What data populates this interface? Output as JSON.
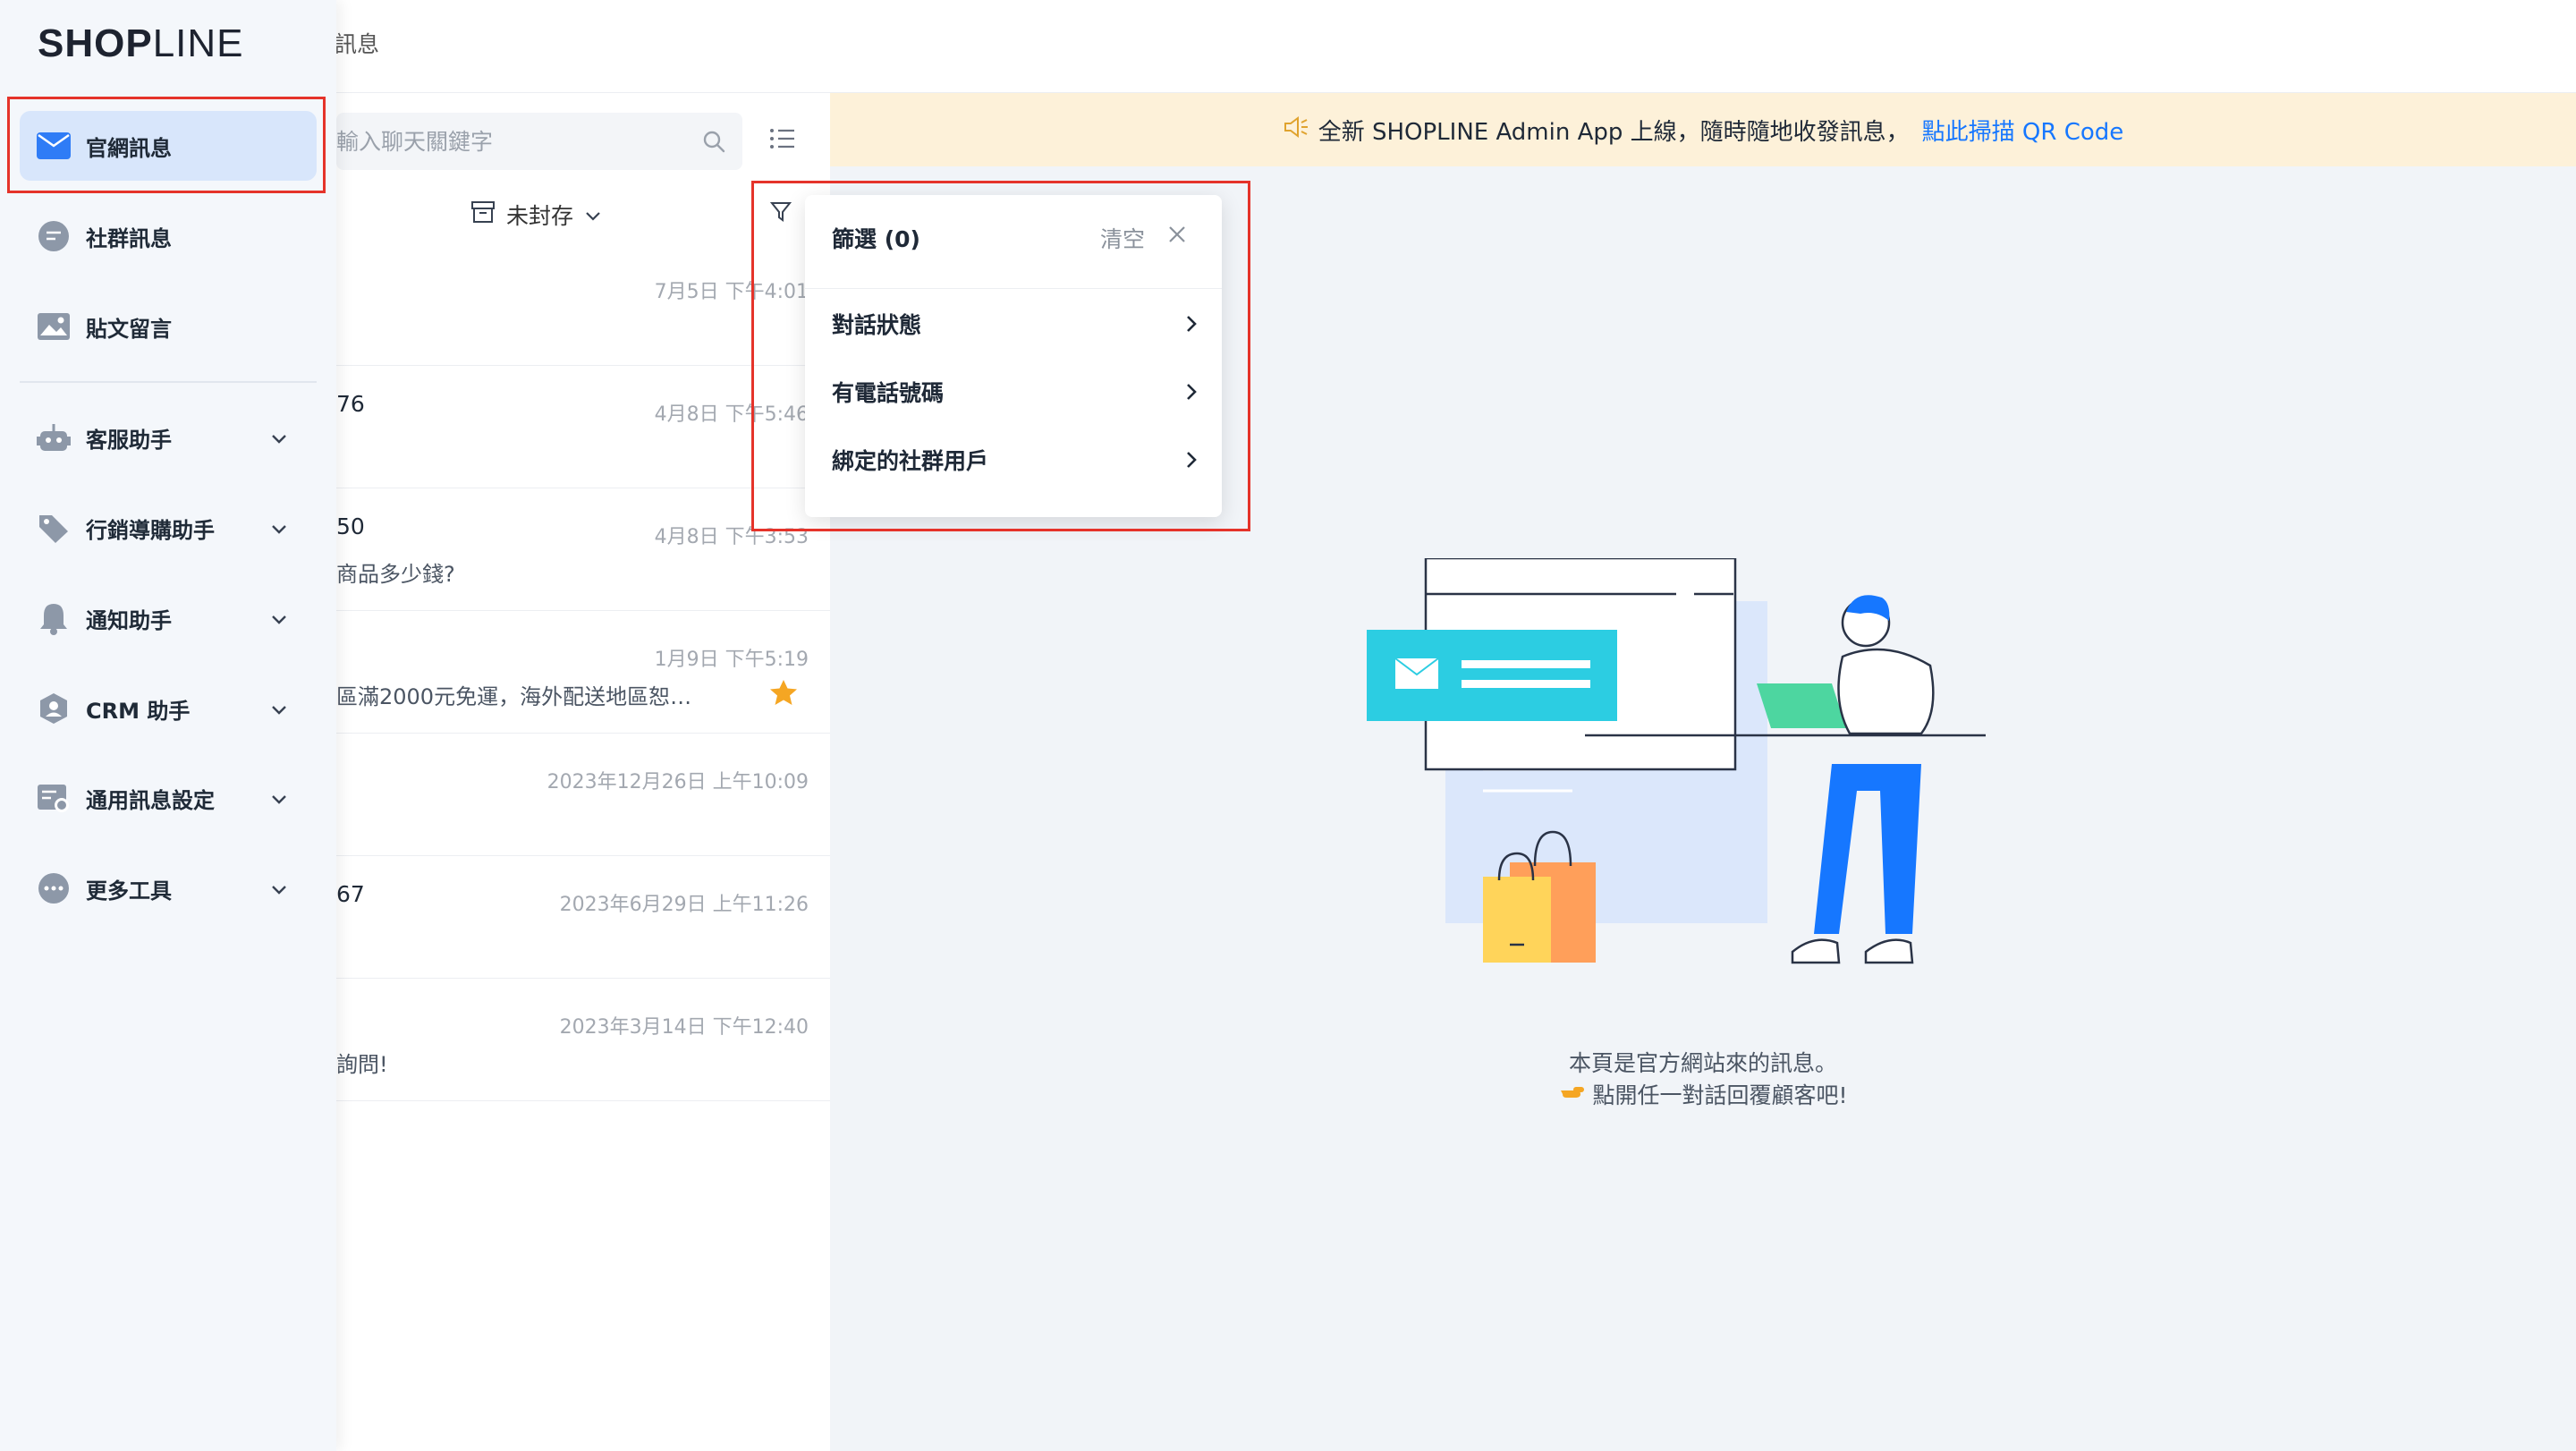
{
  "header": {
    "breadcrumb": "訊息"
  },
  "logo": {
    "bold": "SHOP",
    "light": "LINE"
  },
  "sidebar": {
    "items": [
      {
        "label": "官網訊息",
        "icon": "mail-icon"
      },
      {
        "label": "社群訊息",
        "icon": "chat-bubble-icon"
      },
      {
        "label": "貼文留言",
        "icon": "image-icon"
      },
      {
        "label": "客服助手",
        "icon": "robot-icon"
      },
      {
        "label": "行銷導購助手",
        "icon": "tag-icon"
      },
      {
        "label": "通知助手",
        "icon": "bell-icon"
      },
      {
        "label": "CRM 助手",
        "icon": "crm-icon"
      },
      {
        "label": "通用訊息設定",
        "icon": "settings-card-icon"
      },
      {
        "label": "更多工具",
        "icon": "more-icon"
      }
    ]
  },
  "list": {
    "search_placeholder": "輸入聊天關鍵字",
    "archive_filter": "未封存",
    "rows": [
      {
        "name": "",
        "time": "7月5日 下午4:01",
        "preview": ""
      },
      {
        "name": "76",
        "time": "4月8日 下午5:46",
        "preview": ""
      },
      {
        "name": "50",
        "time": "4月8日 下午3:53",
        "preview": "商品多少錢?"
      },
      {
        "name": "",
        "time": "1月9日 下午5:19",
        "preview": "區滿2000元免運，海外配送地區恕…",
        "starred": true
      },
      {
        "name": "",
        "time": "2023年12月26日 上午10:09",
        "preview": ""
      },
      {
        "name": "67",
        "time": "2023年6月29日 上午11:26",
        "preview": ""
      },
      {
        "name": "",
        "time": "2023年3月14日 下午12:40",
        "preview": "詢問!"
      }
    ]
  },
  "banner": {
    "text": "全新 SHOPLINE Admin App 上線，隨時隨地收發訊息，",
    "link": "點此掃描 QR Code"
  },
  "filter_popover": {
    "title": "篩選 (0)",
    "clear": "清空",
    "items": [
      "對話狀態",
      "有電話號碼",
      "綁定的社群用戶"
    ]
  },
  "empty_state": {
    "line1": "本頁是官方網站來的訊息。",
    "line2": "點開任一對話回覆顧客吧!"
  },
  "colors": {
    "accent": "#1677ff",
    "highlight": "#e5332a",
    "banner_bg": "#fdf1d9",
    "sidebar_active": "#d8e6fb",
    "star": "#f5a623"
  }
}
